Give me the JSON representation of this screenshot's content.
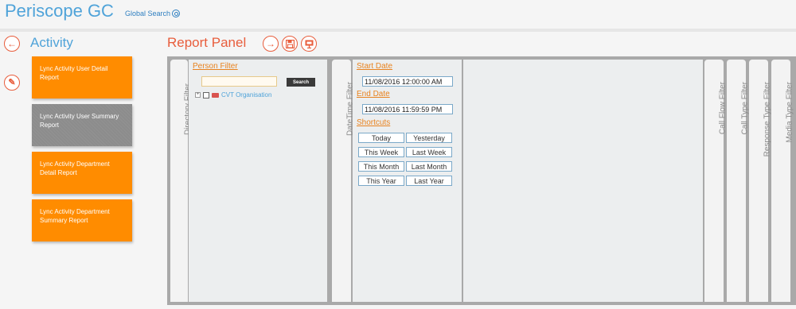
{
  "header": {
    "app_title": "Periscope GC",
    "global_search_label": "Global Search"
  },
  "sidebar": {
    "section_title": "Activity",
    "reports": [
      {
        "label": "Lync Activity User Detail Report",
        "color": "#ff8c00",
        "selected": false
      },
      {
        "label": "Lync Activity User Summary Report",
        "color": "#8c8c8c",
        "selected": true
      },
      {
        "label": "Lync Activity Department Detail Report",
        "color": "#ff8c00",
        "selected": false
      },
      {
        "label": "Lync Activity Department Summary Report",
        "color": "#ff8c00",
        "selected": false
      }
    ]
  },
  "report_panel": {
    "title": "Report Panel",
    "tabs": {
      "directory_filter": "Directory Filter",
      "datetime_filter": "DateTime Filter",
      "call_flow_filter": "Call Flow Filter",
      "call_type_filter": "Call Type Filter",
      "response_type_filter": "Response Type Filter",
      "media_type_filter": "Media Type Filter"
    },
    "directory": {
      "person_filter_label": "Person Filter",
      "search_value": "",
      "search_button": "Search",
      "tree_expander": "+",
      "org_label": "CVT Organisation"
    },
    "datetime": {
      "start_date_label": "Start Date",
      "start_date_value": "11/08/2016 12:00:00 AM",
      "end_date_label": "End Date",
      "end_date_value": "11/08/2016 11:59:59 PM",
      "shortcuts_label": "Shortcuts",
      "shortcuts": [
        "Today",
        "Yesterday",
        "This Week",
        "Last Week",
        "This Month",
        "Last Month",
        "This Year",
        "Last Year"
      ]
    }
  },
  "colors": {
    "accent_blue": "#4fa3d9",
    "accent_red": "#e85d3c",
    "orange": "#ff8c00",
    "link_orange": "#e8821e"
  },
  "icons": {
    "back": "arrow-left-icon",
    "edit": "pencil-icon",
    "go": "arrow-right-icon",
    "save": "floppy-disk-icon",
    "export": "presentation-icon",
    "search": "magnifier-icon"
  }
}
